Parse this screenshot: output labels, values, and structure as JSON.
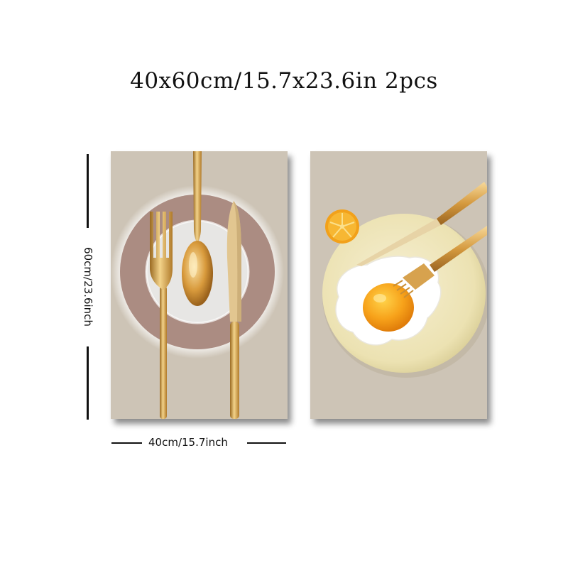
{
  "header": {
    "size_title": "40x60cm/15.7x23.6in 2pcs"
  },
  "dimensions": {
    "height_label": "60cm/23.6inch",
    "width_label": "40cm/15.7inch"
  },
  "colors": {
    "canvas_bg": "#cdc4b6",
    "gold": "#d9a441",
    "plate_ring": "#ab8c82",
    "egg_yolk": "#f39c12"
  },
  "panels": [
    {
      "subject": "fork-spoon-knife-on-plate"
    },
    {
      "subject": "fried-egg-with-lemon-and-cutlery"
    }
  ]
}
